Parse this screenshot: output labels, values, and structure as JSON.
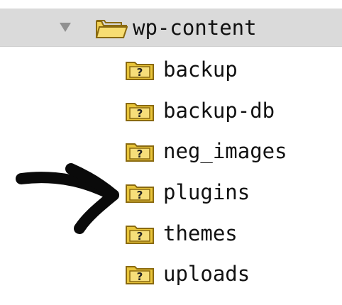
{
  "tree": {
    "parent": {
      "label": "wp-content",
      "expanded": true,
      "icon": "open-folder-icon",
      "disclosure_icon": "triangle-down-icon"
    },
    "children": [
      {
        "label": "backup",
        "icon": "unknown-folder-icon"
      },
      {
        "label": "backup-db",
        "icon": "unknown-folder-icon"
      },
      {
        "label": "neg_images",
        "icon": "unknown-folder-icon"
      },
      {
        "label": "plugins",
        "icon": "unknown-folder-icon"
      },
      {
        "label": "themes",
        "icon": "unknown-folder-icon"
      },
      {
        "label": "uploads",
        "icon": "unknown-folder-icon"
      }
    ]
  },
  "colors": {
    "selection_bg": "#dadada",
    "folder_yellow": "#e8c43a",
    "folder_outline": "#8a6a10",
    "text": "#111111",
    "annotation": "#0a0a0a"
  },
  "annotation": {
    "icon": "hand-drawn-arrow-icon",
    "points_to": "plugins"
  }
}
